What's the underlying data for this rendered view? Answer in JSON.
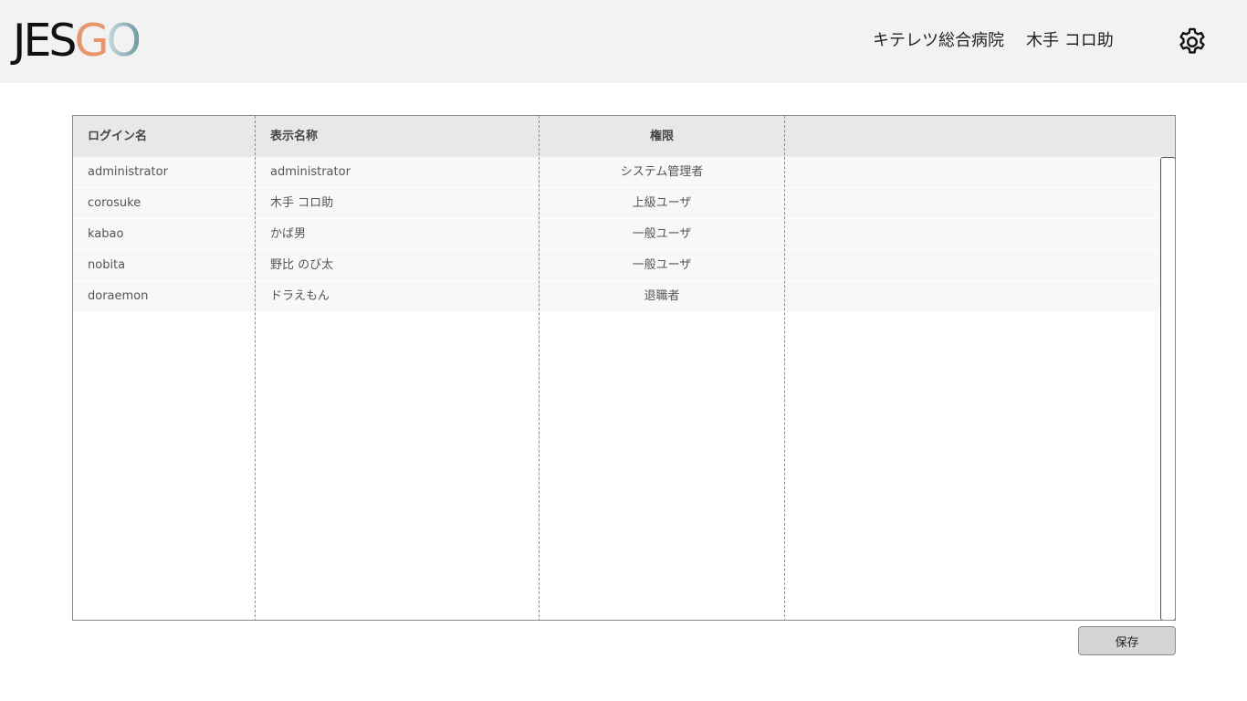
{
  "header": {
    "logo": {
      "letters": [
        "J",
        "E",
        "S",
        "G",
        "O"
      ]
    },
    "hospital_name": "キテレツ総合病院",
    "user_name": "木手 コロ助",
    "settings_icon": "gear-icon"
  },
  "colors": {
    "header_bg": "#f2f2f2",
    "logo_text": "#111111",
    "logo_accent_orange": "#e7956d",
    "logo_accent_teal": "#6d9aa2",
    "table_header_bg": "#e8e8e8",
    "row_bg": "#f8f8f8",
    "button_bg": "#d4d4d4"
  },
  "table": {
    "columns": {
      "login": "ログイン名",
      "display": "表示名称",
      "role": "権限",
      "extra": ""
    },
    "rows": [
      {
        "login": "administrator",
        "display": "administrator",
        "role": "システム管理者"
      },
      {
        "login": "corosuke",
        "display": "木手 コロ助",
        "role": "上級ユーザ"
      },
      {
        "login": "kabao",
        "display": "かば男",
        "role": "一般ユーザ"
      },
      {
        "login": "nobita",
        "display": "野比 のび太",
        "role": "一般ユーザ"
      },
      {
        "login": "doraemon",
        "display": "ドラえもん",
        "role": "退職者"
      }
    ]
  },
  "actions": {
    "save_label": "保存"
  }
}
